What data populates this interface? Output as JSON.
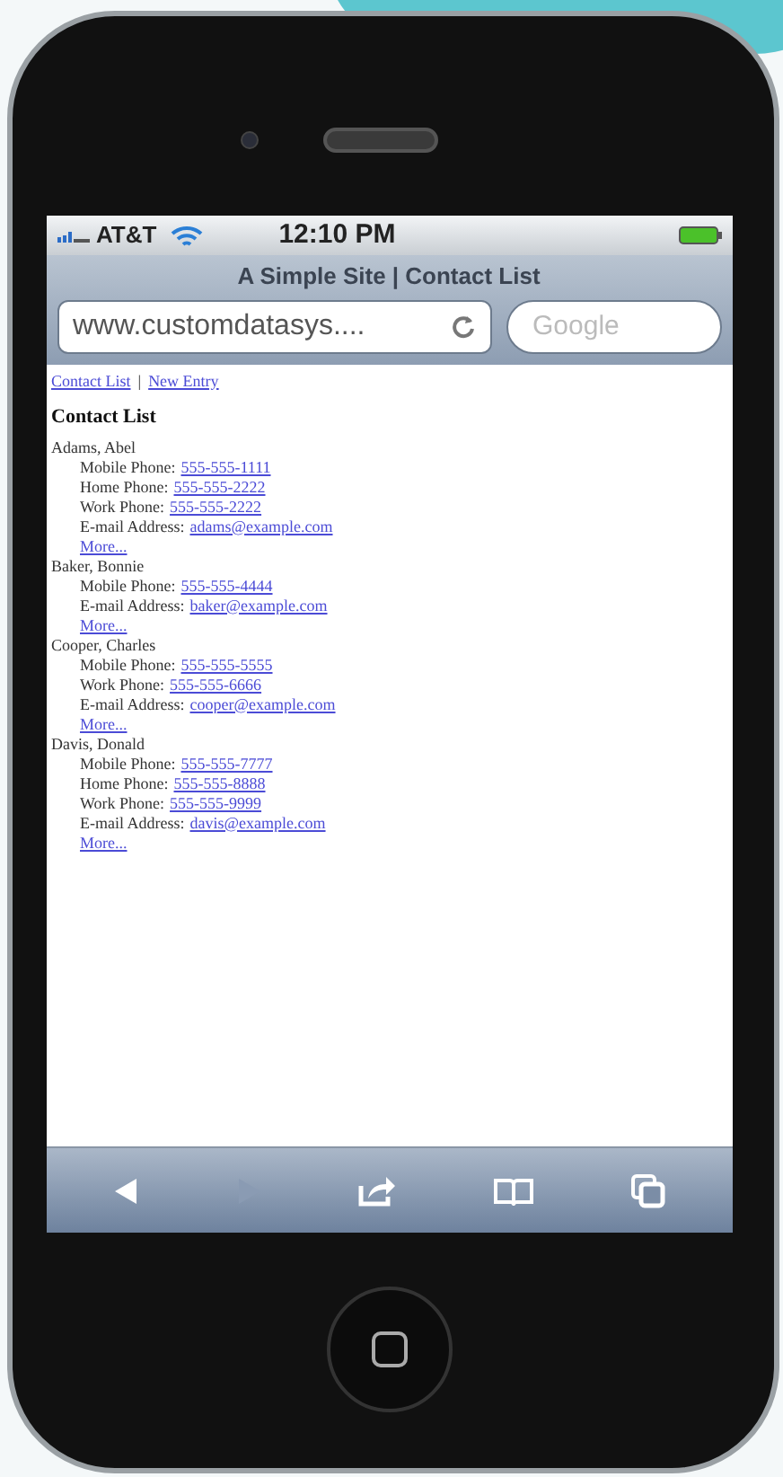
{
  "status_bar": {
    "carrier": "AT&T",
    "time": "12:10 PM"
  },
  "browser": {
    "title": "A Simple Site | Contact List",
    "url": "www.customdatasys....",
    "search_placeholder": "Google"
  },
  "nav_links": [
    {
      "label": "Contact List"
    },
    {
      "label": "New Entry"
    }
  ],
  "nav_separator": "|",
  "heading": "Contact List",
  "contacts": [
    {
      "name": "Adams, Abel",
      "fields": [
        {
          "label": "Mobile Phone:",
          "value": "555-555-1111"
        },
        {
          "label": "Home Phone:",
          "value": "555-555-2222"
        },
        {
          "label": "Work Phone:",
          "value": "555-555-2222"
        },
        {
          "label": "E-mail Address:",
          "value": "adams@example.com"
        }
      ],
      "more": "More..."
    },
    {
      "name": "Baker, Bonnie",
      "fields": [
        {
          "label": "Mobile Phone:",
          "value": "555-555-4444"
        },
        {
          "label": "E-mail Address:",
          "value": "baker@example.com"
        }
      ],
      "more": "More..."
    },
    {
      "name": "Cooper, Charles",
      "fields": [
        {
          "label": "Mobile Phone:",
          "value": "555-555-5555"
        },
        {
          "label": "Work Phone:",
          "value": "555-555-6666"
        },
        {
          "label": "E-mail Address:",
          "value": "cooper@example.com"
        }
      ],
      "more": "More..."
    },
    {
      "name": "Davis, Donald",
      "fields": [
        {
          "label": "Mobile Phone:",
          "value": "555-555-7777"
        },
        {
          "label": "Home Phone:",
          "value": "555-555-8888"
        },
        {
          "label": "Work Phone:",
          "value": "555-555-9999"
        },
        {
          "label": "E-mail Address:",
          "value": "davis@example.com"
        }
      ],
      "more": "More..."
    }
  ],
  "toolbar": {
    "forward_disabled": true
  }
}
